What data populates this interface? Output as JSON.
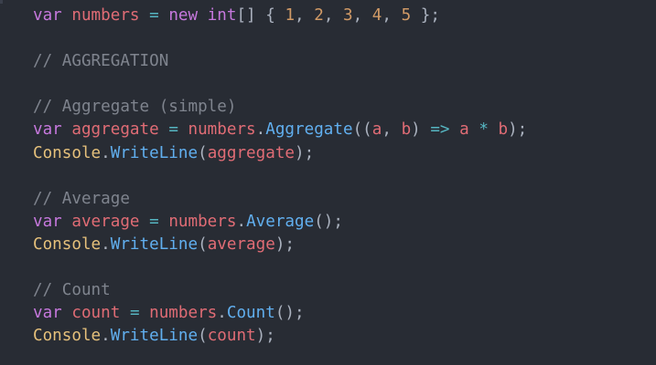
{
  "lines": [
    [
      {
        "t": "var",
        "c": "kw"
      },
      {
        "t": " ",
        "c": "punc"
      },
      {
        "t": "numbers",
        "c": "var"
      },
      {
        "t": " ",
        "c": "punc"
      },
      {
        "t": "=",
        "c": "op"
      },
      {
        "t": " ",
        "c": "punc"
      },
      {
        "t": "new",
        "c": "kw"
      },
      {
        "t": " ",
        "c": "punc"
      },
      {
        "t": "int",
        "c": "kw"
      },
      {
        "t": "[] { ",
        "c": "punc"
      },
      {
        "t": "1",
        "c": "num"
      },
      {
        "t": ", ",
        "c": "punc"
      },
      {
        "t": "2",
        "c": "num"
      },
      {
        "t": ", ",
        "c": "punc"
      },
      {
        "t": "3",
        "c": "num"
      },
      {
        "t": ", ",
        "c": "punc"
      },
      {
        "t": "4",
        "c": "num"
      },
      {
        "t": ", ",
        "c": "punc"
      },
      {
        "t": "5",
        "c": "num"
      },
      {
        "t": " };",
        "c": "punc"
      }
    ],
    [],
    [
      {
        "t": "// AGGREGATION",
        "c": "cmt"
      }
    ],
    [],
    [
      {
        "t": "// Aggregate (simple)",
        "c": "cmt"
      }
    ],
    [
      {
        "t": "var",
        "c": "kw"
      },
      {
        "t": " ",
        "c": "punc"
      },
      {
        "t": "aggregate",
        "c": "var"
      },
      {
        "t": " ",
        "c": "punc"
      },
      {
        "t": "=",
        "c": "op"
      },
      {
        "t": " ",
        "c": "punc"
      },
      {
        "t": "numbers",
        "c": "var"
      },
      {
        "t": ".",
        "c": "punc"
      },
      {
        "t": "Aggregate",
        "c": "fn"
      },
      {
        "t": "((",
        "c": "punc"
      },
      {
        "t": "a",
        "c": "var"
      },
      {
        "t": ", ",
        "c": "punc"
      },
      {
        "t": "b",
        "c": "var"
      },
      {
        "t": ") ",
        "c": "punc"
      },
      {
        "t": "=>",
        "c": "op"
      },
      {
        "t": " ",
        "c": "punc"
      },
      {
        "t": "a",
        "c": "var"
      },
      {
        "t": " ",
        "c": "punc"
      },
      {
        "t": "*",
        "c": "op"
      },
      {
        "t": " ",
        "c": "punc"
      },
      {
        "t": "b",
        "c": "var"
      },
      {
        "t": ");",
        "c": "punc"
      }
    ],
    [
      {
        "t": "Console",
        "c": "cls"
      },
      {
        "t": ".",
        "c": "punc"
      },
      {
        "t": "WriteLine",
        "c": "fn"
      },
      {
        "t": "(",
        "c": "punc"
      },
      {
        "t": "aggregate",
        "c": "var"
      },
      {
        "t": ");",
        "c": "punc"
      }
    ],
    [],
    [
      {
        "t": "// Average",
        "c": "cmt"
      }
    ],
    [
      {
        "t": "var",
        "c": "kw"
      },
      {
        "t": " ",
        "c": "punc"
      },
      {
        "t": "average",
        "c": "var"
      },
      {
        "t": " ",
        "c": "punc"
      },
      {
        "t": "=",
        "c": "op"
      },
      {
        "t": " ",
        "c": "punc"
      },
      {
        "t": "numbers",
        "c": "var"
      },
      {
        "t": ".",
        "c": "punc"
      },
      {
        "t": "Average",
        "c": "fn"
      },
      {
        "t": "();",
        "c": "punc"
      }
    ],
    [
      {
        "t": "Console",
        "c": "cls"
      },
      {
        "t": ".",
        "c": "punc"
      },
      {
        "t": "WriteLine",
        "c": "fn"
      },
      {
        "t": "(",
        "c": "punc"
      },
      {
        "t": "average",
        "c": "var"
      },
      {
        "t": ");",
        "c": "punc"
      }
    ],
    [],
    [
      {
        "t": "// Count",
        "c": "cmt"
      }
    ],
    [
      {
        "t": "var",
        "c": "kw"
      },
      {
        "t": " ",
        "c": "punc"
      },
      {
        "t": "count",
        "c": "var"
      },
      {
        "t": " ",
        "c": "punc"
      },
      {
        "t": "=",
        "c": "op"
      },
      {
        "t": " ",
        "c": "punc"
      },
      {
        "t": "numbers",
        "c": "var"
      },
      {
        "t": ".",
        "c": "punc"
      },
      {
        "t": "Count",
        "c": "fn"
      },
      {
        "t": "();",
        "c": "punc"
      }
    ],
    [
      {
        "t": "Console",
        "c": "cls"
      },
      {
        "t": ".",
        "c": "punc"
      },
      {
        "t": "WriteLine",
        "c": "fn"
      },
      {
        "t": "(",
        "c": "punc"
      },
      {
        "t": "count",
        "c": "var"
      },
      {
        "t": ");",
        "c": "punc"
      }
    ]
  ]
}
